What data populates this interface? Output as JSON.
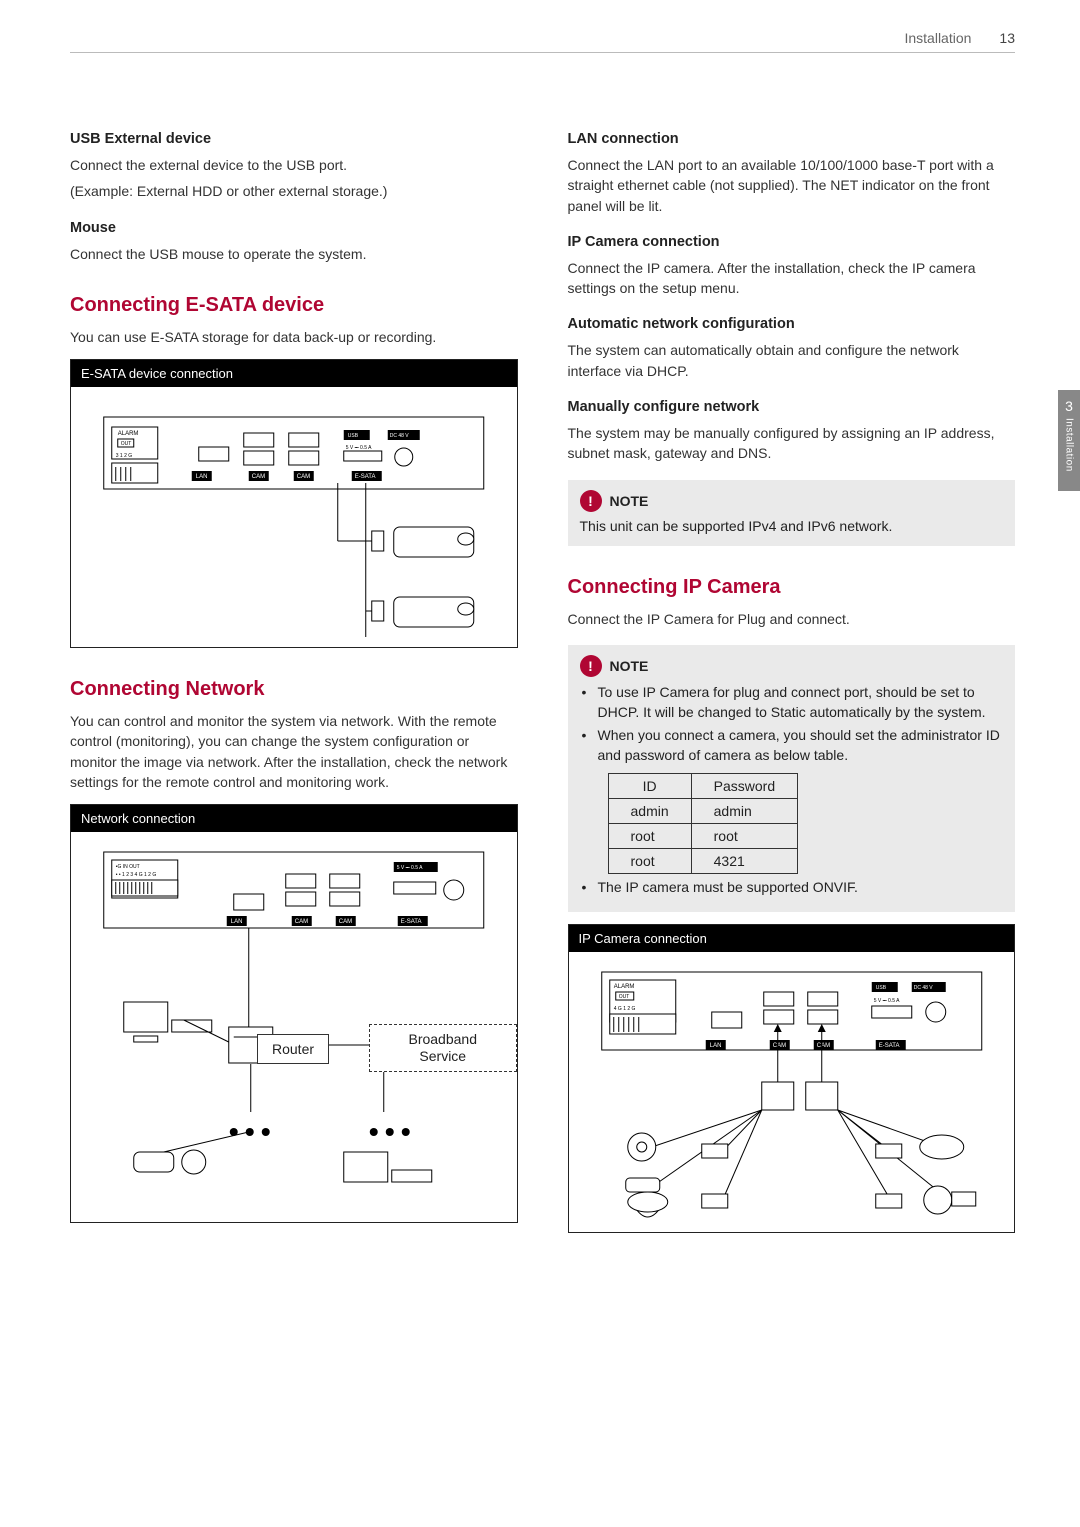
{
  "header": {
    "section": "Installation",
    "page_no": "13"
  },
  "side_tab": {
    "chapter_no": "3",
    "chapter_title": "Installation"
  },
  "left": {
    "usb": {
      "title": "USB External device",
      "p1": "Connect the external device to the USB port.",
      "p2": "(Example: External HDD or other external storage.)"
    },
    "mouse": {
      "title": "Mouse",
      "p1": "Connect the USB mouse to operate the system."
    },
    "esata": {
      "title": "Connecting E-SATA device",
      "p1": "You can use E-SATA storage for data back-up or recording.",
      "diagram_title": "E-SATA device connection"
    },
    "network": {
      "title": "Connecting Network",
      "p1": "You can control and monitor the system via network. With the remote control (monitoring), you can change the system configuration or monitor the image via network. After the installation, check the network settings for the remote control and monitoring work.",
      "diagram_title": "Network connection",
      "router_label": "Router",
      "broadband_label": "Broadband Service"
    }
  },
  "right": {
    "lan": {
      "title": "LAN connection",
      "p1": "Connect the LAN port to an available 10/100/1000 base-T port with a straight ethernet cable (not supplied). The NET indicator on the front panel will be lit."
    },
    "ipcam_conn": {
      "title": "IP Camera connection",
      "p1": "Connect the IP camera. After the installation, check the IP camera settings on the setup menu."
    },
    "auto_net": {
      "title": "Automatic network configuration",
      "p1": "The system can automatically obtain and configure the network interface via DHCP."
    },
    "manual_net": {
      "title": "Manually configure network",
      "p1": "The system may be manually configured by assigning an IP address, subnet mask, gateway and DNS."
    },
    "note1": {
      "label": "NOTE",
      "text": "This unit can be supported IPv4 and IPv6 network."
    },
    "ipcam": {
      "title": "Connecting IP Camera",
      "p1": "Connect the IP Camera for Plug and connect.",
      "note_label": "NOTE",
      "bullet1": "To use IP Camera for plug and connect port, should be set to DHCP. It will be changed to Static automatically by the system.",
      "bullet2": "When you connect a camera, you should set the administrator ID and password of camera as below table.",
      "table": {
        "head_id": "ID",
        "head_pw": "Password",
        "rows": [
          {
            "id": "admin",
            "pw": "admin"
          },
          {
            "id": "root",
            "pw": "root"
          },
          {
            "id": "root",
            "pw": "4321"
          }
        ]
      },
      "bullet3": "The IP camera must be supported ONVIF.",
      "diagram_title": "IP Camera connection"
    }
  }
}
